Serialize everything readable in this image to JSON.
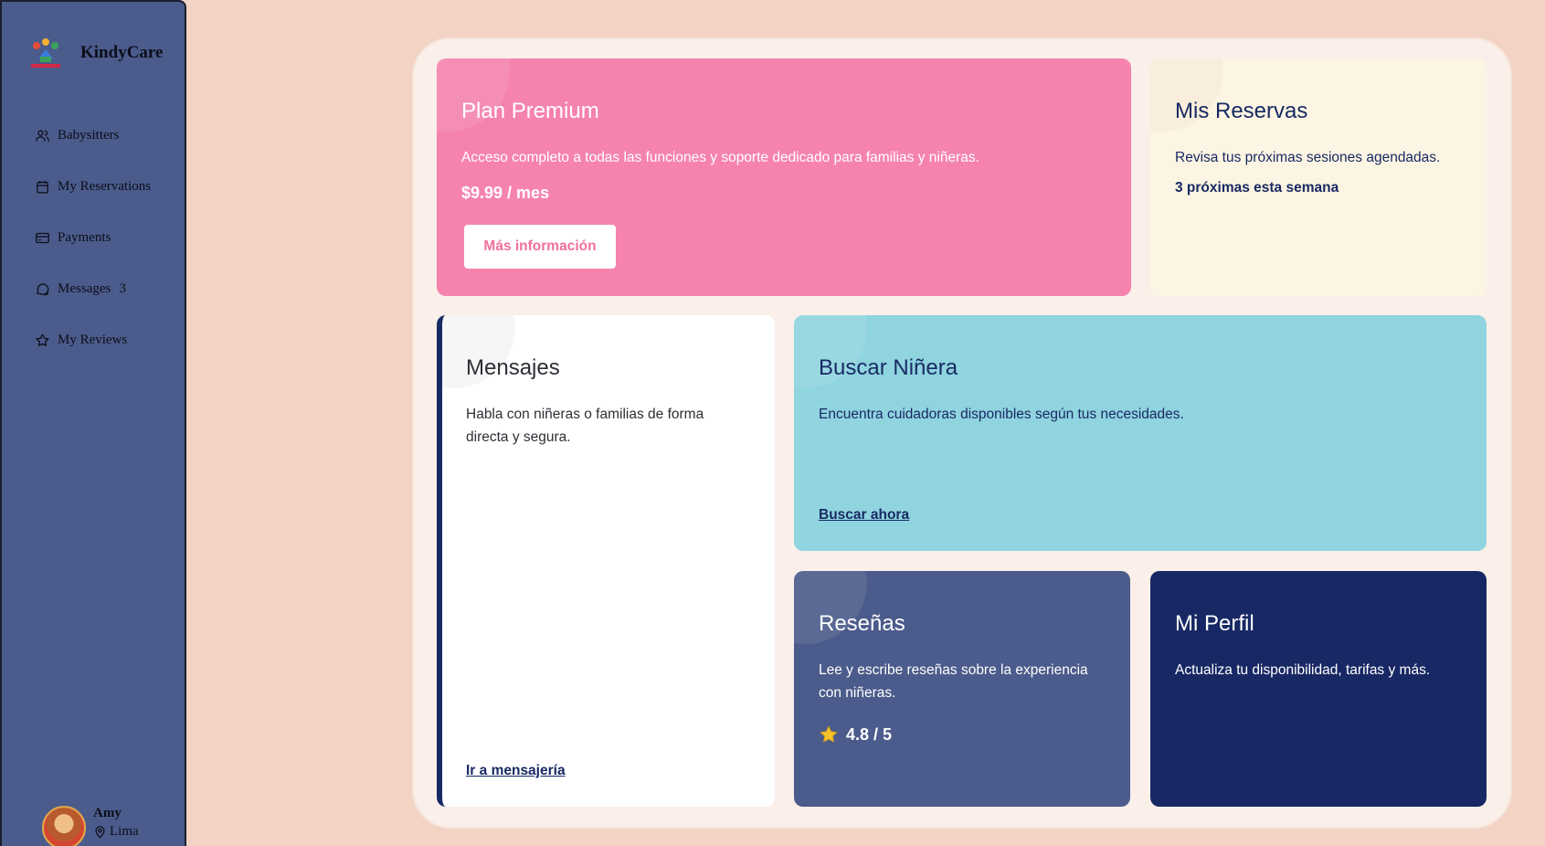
{
  "app": {
    "name": "KindyCare",
    "logo_text": "KINDYCARE"
  },
  "sidebar": {
    "items": [
      {
        "label": "Babysitters",
        "icon": "users-icon"
      },
      {
        "label": "My Reservations",
        "icon": "calendar-icon"
      },
      {
        "label": "Payments",
        "icon": "credit-card-icon"
      },
      {
        "label": "Messages",
        "icon": "chat-icon",
        "badge": "3"
      },
      {
        "label": "My Reviews",
        "icon": "star-icon"
      }
    ]
  },
  "user": {
    "name": "Amy",
    "location": "Lima"
  },
  "cards": {
    "premium": {
      "title": "Plan Premium",
      "description": "Acceso completo a todas las funciones y soporte dedicado para familias y niñeras.",
      "price": "$9.99 / mes",
      "button": "Más información",
      "color": "#f583ae"
    },
    "reservas": {
      "title": "Mis Reservas",
      "description": "Revisa tus próximas sesiones agendadas.",
      "highlight": "3 próximas esta semana",
      "color": "#fdf5e3"
    },
    "mensajes": {
      "title": "Mensajes",
      "description": "Habla con niñeras o familias de forma directa y segura.",
      "link": "Ir a mensajería",
      "color": "#ffffff"
    },
    "buscar": {
      "title": "Buscar Niñera",
      "description": "Encuentra cuidadoras disponibles según tus necesidades.",
      "link": "Buscar ahora",
      "color": "#8fd4df"
    },
    "resenas": {
      "title": "Reseñas",
      "description": "Lee y escribe reseñas sobre la experiencia con niñeras.",
      "rating": "4.8 / 5",
      "color": "#4b5b8b"
    },
    "perfil": {
      "title": "Mi Perfil",
      "description": "Actualiza tu disponibilidad, tarifas y más.",
      "color": "#172864"
    }
  },
  "colors": {
    "background": "#f2d3c4",
    "sidebar": "#4b5b8b",
    "navy": "#182a63"
  }
}
